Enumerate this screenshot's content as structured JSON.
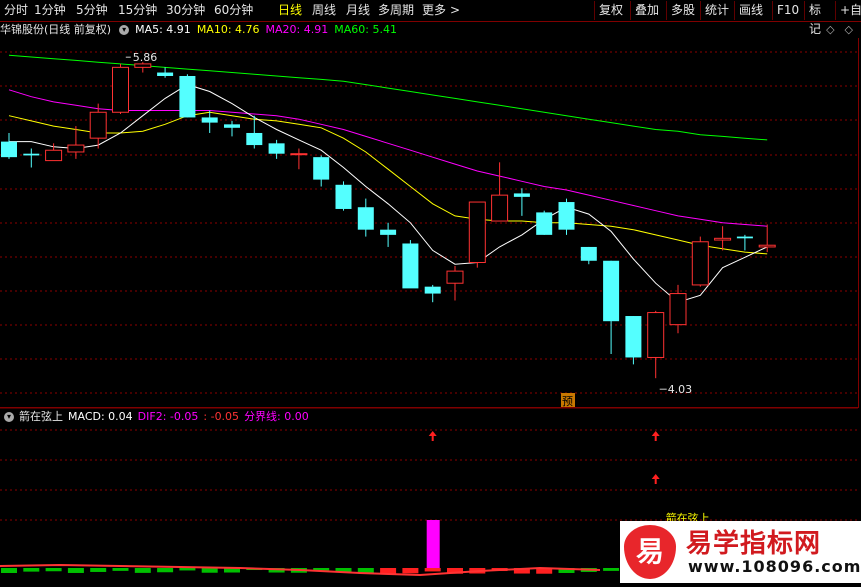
{
  "toolbar": {
    "periods": [
      "分时",
      "1分钟",
      "5分钟",
      "15分钟",
      "30分钟",
      "60分钟",
      "日线",
      "周线",
      "月线",
      "多周期",
      "更多"
    ],
    "active_period": "日线",
    "more_arrow": ">",
    "buttons": [
      "复权",
      "叠加",
      "多股",
      "统计",
      "画线",
      "F10",
      "标记",
      "+自"
    ]
  },
  "main_header": {
    "title": "华锦股份(日线 前复权)",
    "ma5": "MA5: 4.91",
    "ma10": "MA10: 4.76",
    "ma20": "MA20: 4.91",
    "ma60": "MA60: 5.41",
    "max_label": "5.86",
    "min_label": "4.03",
    "forecast_label": "预"
  },
  "sub_header": {
    "indicator": "箭在弦上",
    "macd": "MACD: 0.04",
    "dif2": "DIF2: -0.05",
    "dif2_extra": ": -0.05",
    "divider": "分界线: 0.00",
    "signal_text": "箭在弦上"
  },
  "right_icons": [
    "◇",
    "◇"
  ],
  "watermark": {
    "logo_char": "易",
    "title": "易学指标网",
    "url": "www.108096.com"
  },
  "colors": {
    "up": "#ff3232",
    "down": "#54ffff",
    "ma5": "#ffffff",
    "ma10": "#ffff00",
    "ma20": "#ff00ff",
    "ma60": "#00ff00",
    "grid": "#8b0000",
    "macd_bar": "#ff00ff",
    "arrow": "#ff2020"
  },
  "chart_data": {
    "type": "candlestick",
    "price_range": [
      3.95,
      6.0
    ],
    "candles": [
      {
        "o": 5.4,
        "h": 5.45,
        "l": 5.3,
        "c": 5.31
      },
      {
        "o": 5.33,
        "h": 5.36,
        "l": 5.25,
        "c": 5.32
      },
      {
        "o": 5.29,
        "h": 5.39,
        "l": 5.29,
        "c": 5.35
      },
      {
        "o": 5.34,
        "h": 5.49,
        "l": 5.3,
        "c": 5.38
      },
      {
        "o": 5.42,
        "h": 5.62,
        "l": 5.36,
        "c": 5.57
      },
      {
        "o": 5.57,
        "h": 5.85,
        "l": 5.56,
        "c": 5.83
      },
      {
        "o": 5.83,
        "h": 5.86,
        "l": 5.8,
        "c": 5.85
      },
      {
        "o": 5.8,
        "h": 5.83,
        "l": 5.77,
        "c": 5.78
      },
      {
        "o": 5.78,
        "h": 5.79,
        "l": 5.54,
        "c": 5.54
      },
      {
        "o": 5.54,
        "h": 5.58,
        "l": 5.45,
        "c": 5.51
      },
      {
        "o": 5.5,
        "h": 5.52,
        "l": 5.43,
        "c": 5.48
      },
      {
        "o": 5.45,
        "h": 5.55,
        "l": 5.36,
        "c": 5.38
      },
      {
        "o": 5.39,
        "h": 5.41,
        "l": 5.3,
        "c": 5.33
      },
      {
        "o": 5.33,
        "h": 5.36,
        "l": 5.24,
        "c": 5.33
      },
      {
        "o": 5.31,
        "h": 5.32,
        "l": 5.14,
        "c": 5.18
      },
      {
        "o": 5.15,
        "h": 5.17,
        "l": 5.0,
        "c": 5.01
      },
      {
        "o": 5.02,
        "h": 5.07,
        "l": 4.85,
        "c": 4.89
      },
      {
        "o": 4.89,
        "h": 4.93,
        "l": 4.79,
        "c": 4.86
      },
      {
        "o": 4.81,
        "h": 4.83,
        "l": 4.59,
        "c": 4.55
      },
      {
        "o": 4.56,
        "h": 4.57,
        "l": 4.47,
        "c": 4.52
      },
      {
        "o": 4.58,
        "h": 4.68,
        "l": 4.48,
        "c": 4.65
      },
      {
        "o": 4.7,
        "h": 5.05,
        "l": 4.67,
        "c": 5.05
      },
      {
        "o": 4.94,
        "h": 5.28,
        "l": 4.94,
        "c": 5.09
      },
      {
        "o": 5.1,
        "h": 5.13,
        "l": 4.97,
        "c": 5.08
      },
      {
        "o": 4.99,
        "h": 5.0,
        "l": 4.86,
        "c": 4.86
      },
      {
        "o": 5.05,
        "h": 5.07,
        "l": 4.86,
        "c": 4.89
      },
      {
        "o": 4.79,
        "h": 4.79,
        "l": 4.69,
        "c": 4.71
      },
      {
        "o": 4.71,
        "h": 4.71,
        "l": 4.17,
        "c": 4.36
      },
      {
        "o": 4.39,
        "h": 4.39,
        "l": 4.11,
        "c": 4.15
      },
      {
        "o": 4.15,
        "h": 4.42,
        "l": 4.03,
        "c": 4.41
      },
      {
        "o": 4.34,
        "h": 4.57,
        "l": 4.29,
        "c": 4.52
      },
      {
        "o": 4.57,
        "h": 4.85,
        "l": 4.56,
        "c": 4.82
      },
      {
        "o": 4.83,
        "h": 4.91,
        "l": 4.77,
        "c": 4.84
      },
      {
        "o": 4.85,
        "h": 4.86,
        "l": 4.77,
        "c": 4.84
      },
      {
        "o": 4.79,
        "h": 4.92,
        "l": 4.76,
        "c": 4.8
      }
    ],
    "ma5": [
      5.4,
      5.4,
      5.37,
      5.36,
      5.38,
      5.45,
      5.55,
      5.65,
      5.73,
      5.69,
      5.62,
      5.54,
      5.47,
      5.41,
      5.35,
      5.25,
      5.14,
      5.04,
      4.93,
      4.77,
      4.69,
      4.7,
      4.79,
      4.86,
      4.95,
      5.02,
      4.98,
      4.88,
      4.72,
      4.58,
      4.47,
      4.51,
      4.67,
      4.73,
      4.79
    ],
    "ma10": [
      5.55,
      5.52,
      5.49,
      5.47,
      5.45,
      5.45,
      5.46,
      5.5,
      5.55,
      5.57,
      5.55,
      5.53,
      5.52,
      5.5,
      5.48,
      5.42,
      5.34,
      5.24,
      5.14,
      5.04,
      4.97,
      4.95,
      4.94,
      4.94,
      4.93,
      4.93,
      4.92,
      4.91,
      4.89,
      4.86,
      4.83,
      4.8,
      4.78,
      4.76,
      4.75
    ],
    "ma20": [
      5.7,
      5.66,
      5.63,
      5.61,
      5.59,
      5.58,
      5.58,
      5.58,
      5.58,
      5.58,
      5.57,
      5.56,
      5.55,
      5.53,
      5.5,
      5.47,
      5.43,
      5.39,
      5.35,
      5.31,
      5.27,
      5.23,
      5.2,
      5.17,
      5.14,
      5.12,
      5.09,
      5.06,
      5.03,
      5.0,
      4.97,
      4.95,
      4.93,
      4.92,
      4.91
    ],
    "ma60": [
      5.9,
      5.89,
      5.88,
      5.87,
      5.86,
      5.85,
      5.84,
      5.83,
      5.82,
      5.81,
      5.8,
      5.79,
      5.78,
      5.77,
      5.76,
      5.75,
      5.73,
      5.71,
      5.69,
      5.67,
      5.65,
      5.63,
      5.61,
      5.59,
      5.57,
      5.55,
      5.53,
      5.51,
      5.49,
      5.47,
      5.46,
      5.44,
      5.43,
      5.42,
      5.41
    ],
    "signal_arrow_indices": [
      19,
      29
    ],
    "signal_double_arrow_index": 29,
    "macd_bar_index": 19
  }
}
